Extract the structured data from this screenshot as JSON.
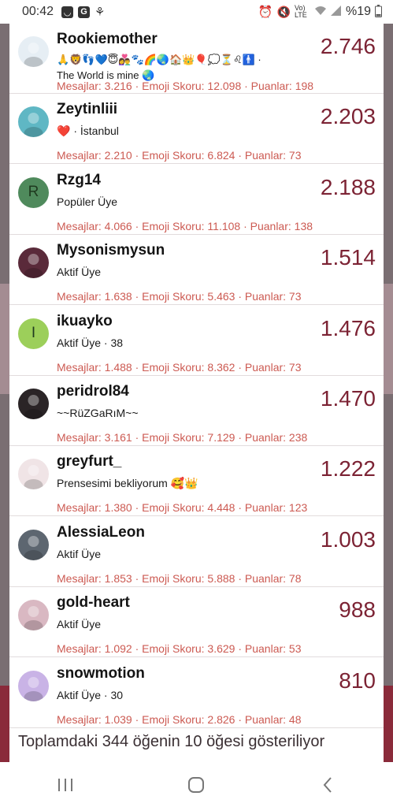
{
  "status_bar": {
    "time": "00:42",
    "icons": [
      "message-icon",
      "g-icon",
      "app-icon"
    ],
    "right_icons": [
      "alarm-icon",
      "mute-icon",
      "volte-icon",
      "wifi-icon",
      "signal-icon"
    ],
    "volte_label": "Vo) LTE",
    "battery": "%19"
  },
  "members": [
    {
      "name": "Rookiemother",
      "subtitle": "🙏🦁👣💙😇👩‍❤️‍👨🐾🌈🌏🏠👑🎈💭⏳♌🚹 ·",
      "subtitle2": "The World is mine 🌏",
      "stats": "Mesajlar: 3.216 · Emoji Skoru: 12.098 · Puanlar: 198",
      "score": "2.746",
      "avatar_type": "image",
      "avatar_icon": "cartoon-avatar-icon",
      "avatar_color": "#e6eef4"
    },
    {
      "name": "Zeytinliii",
      "subtitle": "❤️ · İstanbul",
      "subtitle2": "",
      "stats": "Mesajlar: 2.210 · Emoji Skoru: 6.824 · Puanlar: 73",
      "score": "2.203",
      "avatar_type": "image",
      "avatar_icon": "photo-avatar-icon",
      "avatar_color": "#5fb7c4"
    },
    {
      "name": "Rzg14",
      "subtitle": "Popüler Üye",
      "subtitle2": "",
      "stats": "Mesajlar: 4.066 · Emoji Skoru: 11.108 · Puanlar: 138",
      "score": "2.188",
      "avatar_type": "letter",
      "avatar_letter": "R",
      "avatar_color": "#4f8a5c"
    },
    {
      "name": "Mysonismysun",
      "subtitle": "Aktif Üye",
      "subtitle2": "",
      "stats": "Mesajlar: 1.638 · Emoji Skoru: 5.463 · Puanlar: 73",
      "score": "1.514",
      "avatar_type": "image",
      "avatar_icon": "photo-avatar-icon",
      "avatar_color": "#5a2a3a"
    },
    {
      "name": "ikuayko",
      "subtitle": "Aktif Üye · 38",
      "subtitle2": "",
      "stats": "Mesajlar: 1.488 · Emoji Skoru: 8.362 · Puanlar: 73",
      "score": "1.476",
      "avatar_type": "letter",
      "avatar_letter": "I",
      "avatar_color": "#9ccf5a"
    },
    {
      "name": "peridrol84",
      "subtitle": "~~RüZGaRıM~~",
      "subtitle2": "",
      "stats": "Mesajlar: 3.161 · Emoji Skoru: 7.129 · Puanlar: 238",
      "score": "1.470",
      "avatar_type": "image",
      "avatar_icon": "photo-avatar-icon",
      "avatar_color": "#2a2426"
    },
    {
      "name": "greyfurt_",
      "subtitle": "Prensesimi bekliyorum 🥰👑",
      "subtitle2": "",
      "stats": "Mesajlar: 1.380 · Emoji Skoru: 4.448 · Puanlar: 123",
      "score": "1.222",
      "avatar_type": "image",
      "avatar_icon": "photo-avatar-icon",
      "avatar_color": "#f0e4e6"
    },
    {
      "name": "AlessiaLeon",
      "subtitle": "Aktif Üye",
      "subtitle2": "",
      "stats": "Mesajlar: 1.853 · Emoji Skoru: 5.888 · Puanlar: 78",
      "score": "1.003",
      "avatar_type": "image",
      "avatar_icon": "photo-avatar-icon",
      "avatar_color": "#5d6670"
    },
    {
      "name": "gold-heart",
      "subtitle": "Aktif Üye",
      "subtitle2": "",
      "stats": "Mesajlar: 1.092 · Emoji Skoru: 3.629 · Puanlar: 53",
      "score": "988",
      "avatar_type": "image",
      "avatar_icon": "photo-avatar-icon",
      "avatar_color": "#d9b8c2"
    },
    {
      "name": "snowmotion",
      "subtitle": "Aktif Üye · 30",
      "subtitle2": "",
      "stats": "Mesajlar: 1.039 · Emoji Skoru: 2.826 · Puanlar: 48",
      "score": "810",
      "avatar_type": "image",
      "avatar_icon": "cartoon-avatar-icon",
      "avatar_color": "#c9b3e6"
    }
  ],
  "footer": "Toplamdaki 344 öğenin 10 öğesi gösteriliyor",
  "nav": {
    "recent": "recent-apps-icon",
    "home": "home-icon",
    "back": "back-icon"
  },
  "colors": {
    "score": "#7c2334",
    "stats": "#cc5a52",
    "name": "#141414"
  }
}
